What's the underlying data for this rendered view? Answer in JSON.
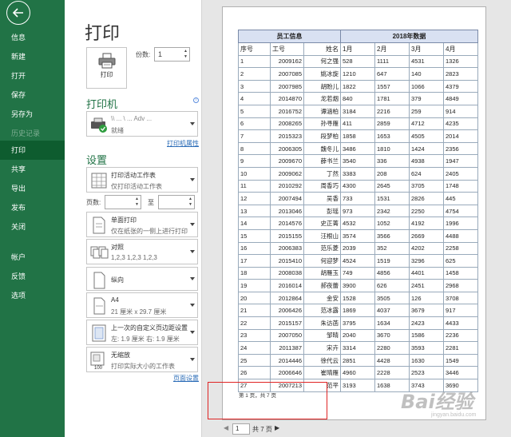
{
  "nav": {
    "items": [
      {
        "label": "信息",
        "state": "normal"
      },
      {
        "label": "新建",
        "state": "normal"
      },
      {
        "label": "打开",
        "state": "normal"
      },
      {
        "label": "保存",
        "state": "normal"
      },
      {
        "label": "另存为",
        "state": "normal"
      },
      {
        "label": "历史记录",
        "state": "disabled"
      },
      {
        "label": "打印",
        "state": "active"
      },
      {
        "label": "共享",
        "state": "normal"
      },
      {
        "label": "导出",
        "state": "normal"
      },
      {
        "label": "发布",
        "state": "normal"
      },
      {
        "label": "关闭",
        "state": "normal"
      },
      {
        "label": "帐户",
        "state": "normal"
      },
      {
        "label": "反馈",
        "state": "normal"
      },
      {
        "label": "选项",
        "state": "normal"
      }
    ]
  },
  "print": {
    "title": "打印",
    "button_label": "打印",
    "copies_label": "份数:",
    "copies_value": "1"
  },
  "printer": {
    "heading": "打印机",
    "name": "\\\\ ... \\ ... Adv ...",
    "status": "就绪",
    "properties_link": "打印机属性"
  },
  "settings": {
    "heading": "设置",
    "scope": {
      "title": "打印活动工作表",
      "desc": "仅打印活动工作表"
    },
    "pages_label": "页数:",
    "to_label": "至",
    "sides": {
      "title": "单面打印",
      "desc": "仅在纸张的一侧上进行打印"
    },
    "collate": {
      "title": "对照",
      "desc": "1,2,3    1,2,3    1,2,3"
    },
    "orientation": {
      "title": "纵向"
    },
    "paper": {
      "title": "A4",
      "desc": "21 厘米 x 29.7 厘米"
    },
    "margins": {
      "title": "上一次的自定义页边距设置",
      "desc": "左: 1.9 厘米    右: 1.9 厘米"
    },
    "scaling": {
      "title": "无缩放",
      "desc": "打印实际大小的工作表"
    },
    "page_setup_link": "页面设置"
  },
  "sheet": {
    "group1": "员工信息",
    "group2": "2018年数据",
    "headers": [
      "序号",
      "工号",
      "姓名",
      "1月",
      "2月",
      "3月",
      "4月"
    ],
    "rows": [
      [
        "1",
        "2009162",
        "何之强",
        "528",
        "1111",
        "4531",
        "1326"
      ],
      [
        "2",
        "2007085",
        "姚冰旋",
        "1210",
        "647",
        "140",
        "2823"
      ],
      [
        "3",
        "2007985",
        "胡盼儿",
        "1822",
        "1557",
        "1066",
        "4379"
      ],
      [
        "4",
        "2014870",
        "龙若烟",
        "840",
        "1781",
        "379",
        "4849"
      ],
      [
        "5",
        "2016752",
        "谭涵柏",
        "3184",
        "2216",
        "259",
        "914"
      ],
      [
        "6",
        "2008265",
        "孙寻雁",
        "411",
        "2859",
        "4712",
        "4235"
      ],
      [
        "7",
        "2015323",
        "段梦柏",
        "1858",
        "1653",
        "4505",
        "2014"
      ],
      [
        "8",
        "2006305",
        "魏冬儿",
        "3486",
        "1810",
        "1424",
        "2356"
      ],
      [
        "9",
        "2009670",
        "薛书兰",
        "3540",
        "336",
        "4938",
        "1947"
      ],
      [
        "10",
        "2009062",
        "丁然",
        "3383",
        "208",
        "624",
        "2405"
      ],
      [
        "11",
        "2010292",
        "周香巧",
        "4300",
        "2645",
        "3705",
        "1748"
      ],
      [
        "12",
        "2007494",
        "吴香",
        "733",
        "1531",
        "2826",
        "445"
      ],
      [
        "13",
        "2013046",
        "彭瑶",
        "973",
        "2342",
        "2250",
        "4754"
      ],
      [
        "14",
        "2014576",
        "史正菁",
        "4532",
        "1052",
        "4192",
        "1996"
      ],
      [
        "15",
        "2015155",
        "汪根山",
        "3574",
        "3566",
        "2669",
        "4488"
      ],
      [
        "16",
        "2006383",
        "范乐菱",
        "2039",
        "352",
        "4202",
        "2258"
      ],
      [
        "17",
        "2015410",
        "何迎梦",
        "4524",
        "1519",
        "3296",
        "625"
      ],
      [
        "18",
        "2008038",
        "胡雁玉",
        "749",
        "4856",
        "4401",
        "1458"
      ],
      [
        "19",
        "2016014",
        "郝夜蕾",
        "3900",
        "626",
        "2451",
        "2968"
      ],
      [
        "20",
        "2012864",
        "金安",
        "1528",
        "3505",
        "126",
        "3708"
      ],
      [
        "21",
        "2006426",
        "范冰露",
        "1869",
        "4037",
        "3679",
        "917"
      ],
      [
        "22",
        "2015157",
        "朱访菡",
        "3795",
        "1634",
        "2423",
        "4433"
      ],
      [
        "23",
        "2007050",
        "邹晴",
        "2040",
        "3670",
        "1586",
        "2236"
      ],
      [
        "24",
        "2011387",
        "宋卉",
        "3314",
        "2280",
        "3593",
        "2281"
      ],
      [
        "25",
        "2014446",
        "徐代云",
        "2851",
        "4428",
        "1630",
        "1549"
      ],
      [
        "26",
        "2006646",
        "崔晴雁",
        "4960",
        "2228",
        "2523",
        "3446"
      ],
      [
        "27",
        "2007213",
        "范平",
        "3193",
        "1638",
        "3743",
        "3690"
      ]
    ],
    "footer": "第 1 页，共 7 页"
  },
  "pager": {
    "current": "1",
    "total_label": "共 7 页"
  },
  "watermark": {
    "logo": "Bai经验",
    "url": "jingyan.baidu.com"
  }
}
